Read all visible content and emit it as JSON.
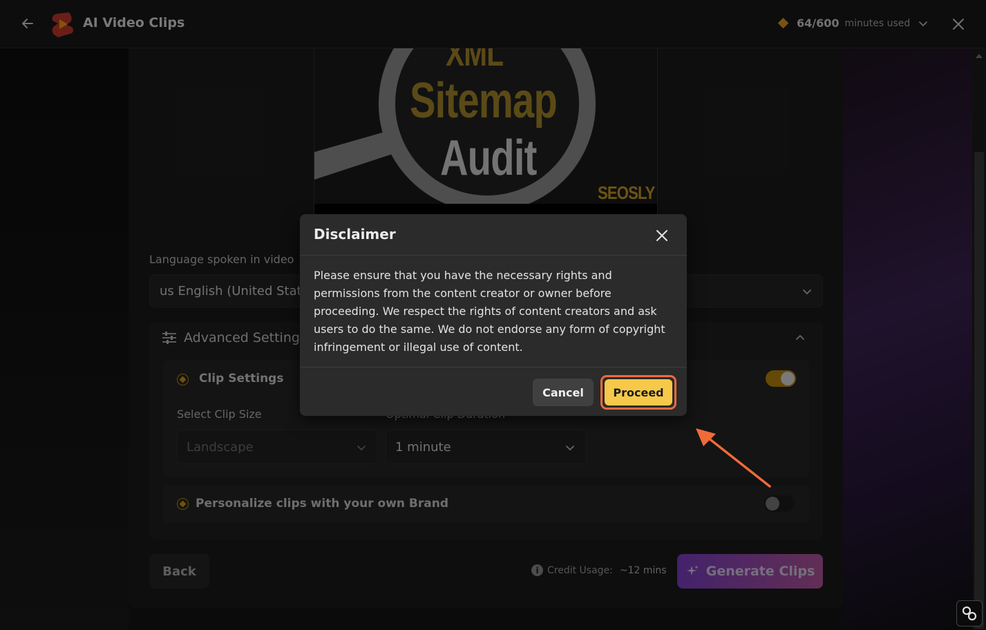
{
  "header": {
    "title": "AI Video Clips",
    "usage_count": "64/600",
    "usage_label": "minutes used"
  },
  "thumbnail": {
    "line1": "XML",
    "line2": "Sitemap",
    "line3": "Audit",
    "brand": "SEOSLY"
  },
  "language": {
    "label": "Language spoken in video",
    "value": "us English (United States)"
  },
  "advanced": {
    "title": "Advanced Settings",
    "clip_settings": {
      "title": "Clip Settings",
      "enabled": true,
      "size_label": "Select Clip Size",
      "size_value": "Landscape",
      "duration_label": "Optimal Clip Duration",
      "duration_value": "1 minute"
    },
    "brand": {
      "title": "Personalize clips with your own Brand",
      "enabled": false
    }
  },
  "footer": {
    "back_label": "Back",
    "credit_label": "Credit Usage:",
    "credit_value": "~12 mins",
    "generate_label": "Generate Clips"
  },
  "modal": {
    "title": "Disclaimer",
    "body": "Please ensure that you have the necessary rights and permissions from the content creator or owner before proceeding. We respect the rights of content creators and ask users to do the same. We do not endorse any form of copyright infringement or illegal use of content.",
    "cancel_label": "Cancel",
    "proceed_label": "Proceed"
  },
  "colors": {
    "accent": "#f6c94a",
    "highlight": "#ef6b3a",
    "generate_start": "#7b3fc4",
    "generate_end": "#b2559a",
    "toggle_on": "#b8860b"
  },
  "icons": [
    "back-arrow-icon",
    "logo-icon",
    "diamond-icon",
    "chevron-down-icon",
    "close-icon",
    "sliders-icon",
    "chevron-up-icon",
    "crown-icon",
    "info-icon",
    "sparkle-icon",
    "link-icon"
  ]
}
